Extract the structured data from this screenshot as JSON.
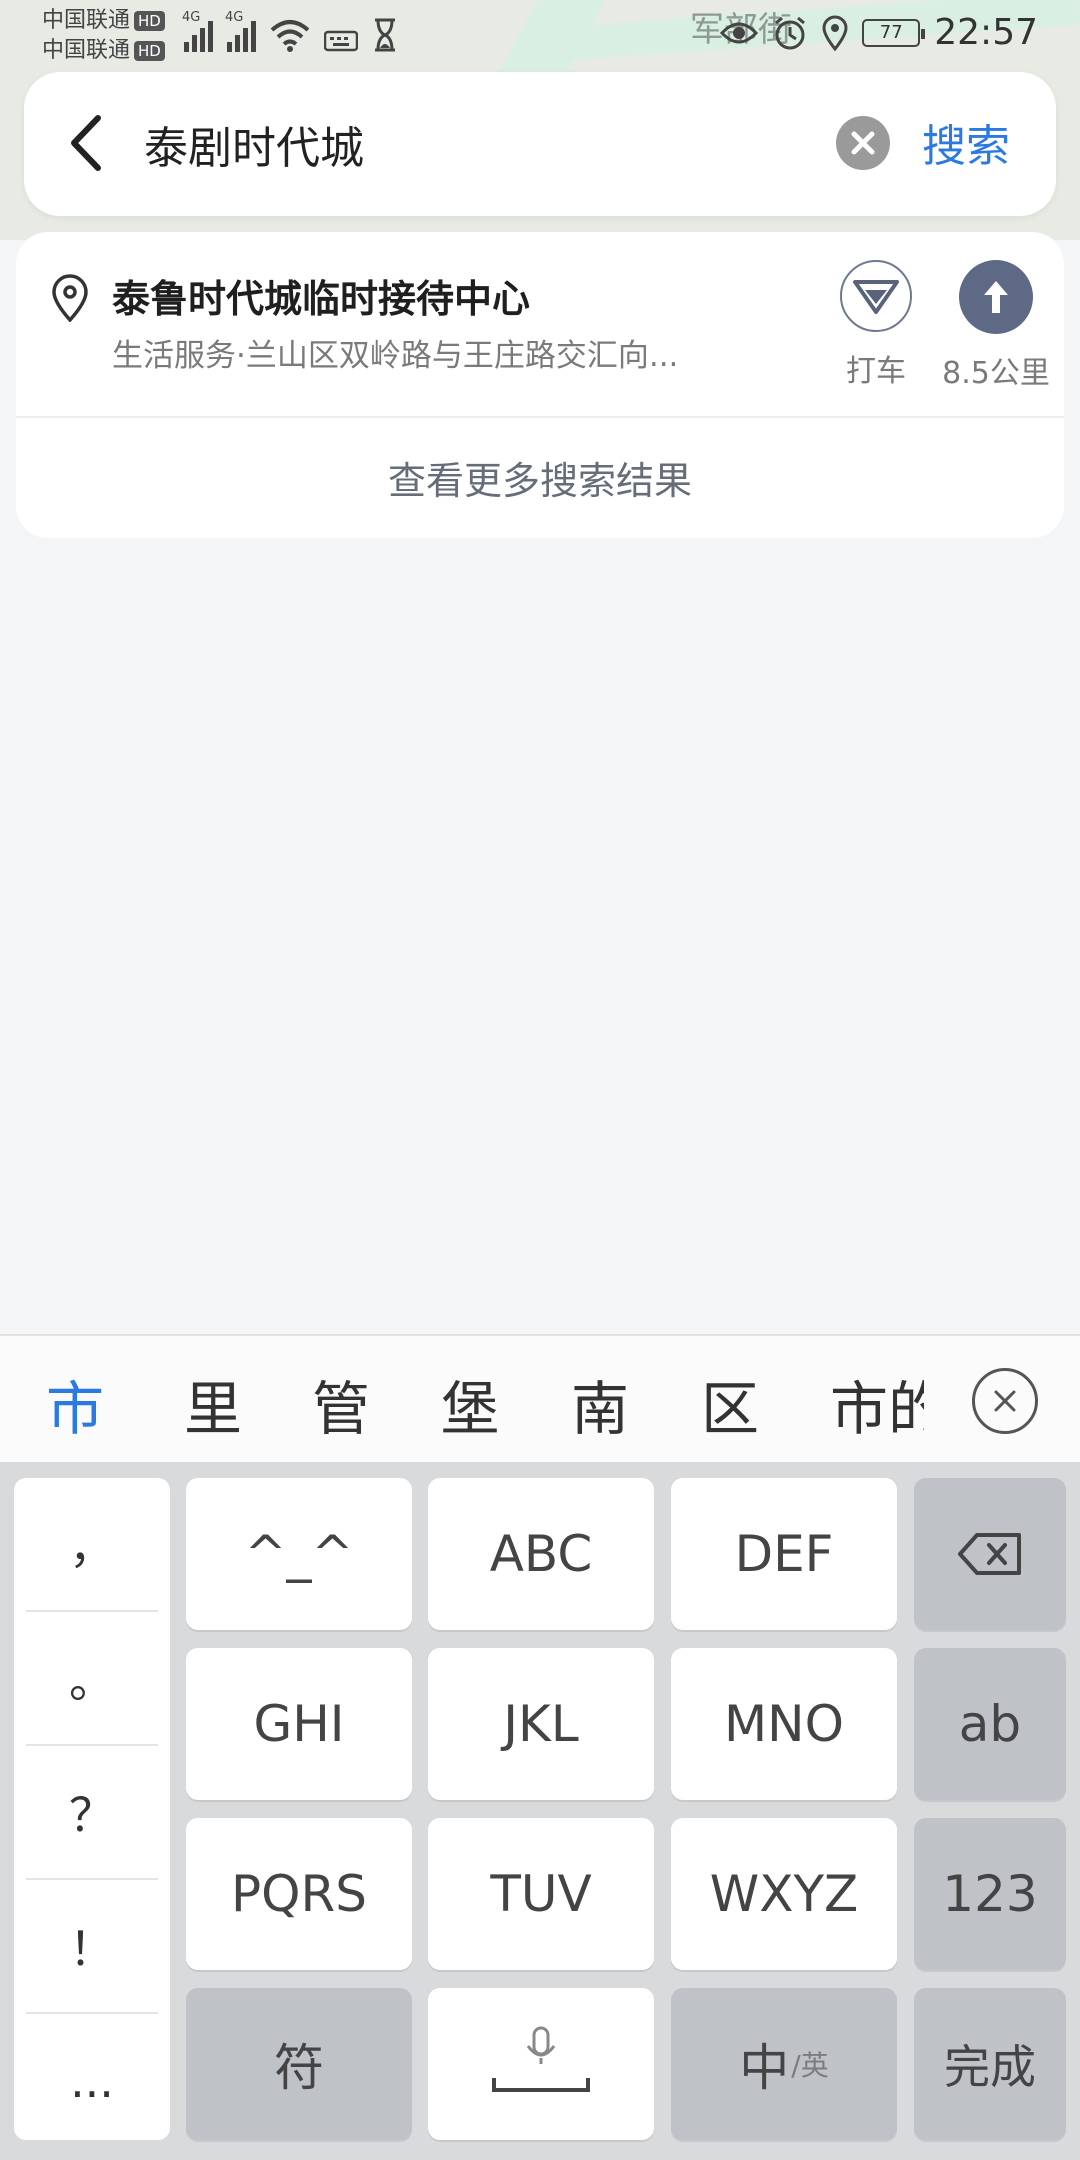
{
  "status_bar": {
    "carrier_1": "中国联通",
    "carrier_2": "中国联通",
    "hd": "HD",
    "network": "4G",
    "battery": "77",
    "time": "22:57"
  },
  "map": {
    "label": "军部街"
  },
  "search": {
    "query": "泰剧时代城",
    "submit_label": "搜索"
  },
  "result": {
    "title": "泰鲁时代城临时接待中心",
    "subtitle": "生活服务·兰山区双岭路与王庄路交汇向...",
    "taxi_label": "打车",
    "distance": "8.5公里",
    "more_label": "查看更多搜索结果"
  },
  "candidates": [
    "市",
    "里",
    "管",
    "堡",
    "南",
    "区",
    "市的"
  ],
  "keyboard": {
    "punctuation": [
      "，",
      "。",
      "？",
      "！",
      "..."
    ],
    "row1": [
      "^_^",
      "ABC",
      "DEF"
    ],
    "row2": [
      "GHI",
      "JKL",
      "MNO",
      "ab"
    ],
    "row3": [
      "PQRS",
      "TUV",
      "WXYZ",
      "123"
    ],
    "symbol_key": "符",
    "lang_main": "中",
    "lang_sub": "/英",
    "done_key": "完成"
  },
  "colors": {
    "accent": "#2a7ae2",
    "nav_button": "#5d6985"
  }
}
